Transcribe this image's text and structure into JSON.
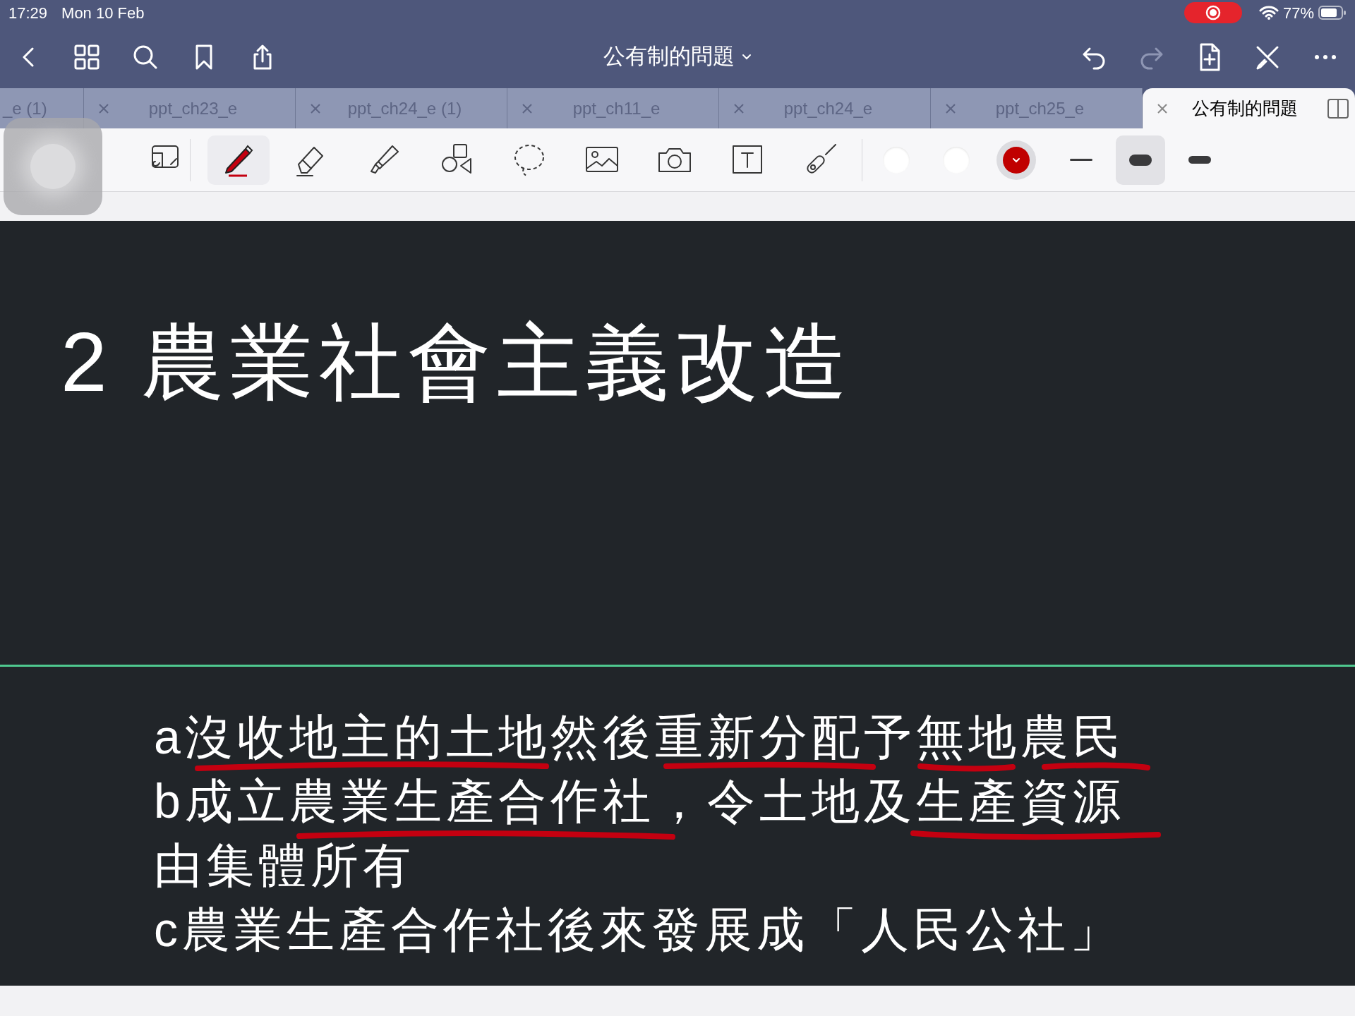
{
  "status_bar": {
    "time": "17:29",
    "date": "Mon 10 Feb",
    "recording": true,
    "battery": "77%"
  },
  "nav": {
    "title": "公有制的問題"
  },
  "tabs": [
    {
      "label": "_e (1)",
      "selected": false,
      "closable": false
    },
    {
      "label": "ppt_ch23_e",
      "selected": false,
      "closable": true
    },
    {
      "label": "ppt_ch24_e (1)",
      "selected": false,
      "closable": true
    },
    {
      "label": "ppt_ch11_e",
      "selected": false,
      "closable": true
    },
    {
      "label": "ppt_ch24_e",
      "selected": false,
      "closable": true
    },
    {
      "label": "ppt_ch25_e",
      "selected": false,
      "closable": true
    },
    {
      "label": "公有制的問題",
      "selected": true,
      "closable": true
    }
  ],
  "tools": [
    {
      "kind": "scan",
      "selected": false
    },
    {
      "kind": "pen",
      "selected": true
    },
    {
      "kind": "eraser",
      "selected": false
    },
    {
      "kind": "highlighter",
      "selected": false
    },
    {
      "kind": "shapes",
      "selected": false
    },
    {
      "kind": "lasso",
      "selected": false
    },
    {
      "kind": "image",
      "selected": false
    },
    {
      "kind": "camera",
      "selected": false
    },
    {
      "kind": "text",
      "selected": false
    },
    {
      "kind": "laser",
      "selected": false
    }
  ],
  "colors": [
    {
      "color": "#ffffff",
      "selected": false
    },
    {
      "color": "#ffffff",
      "selected": false
    },
    {
      "color": "#c00000",
      "selected": true
    }
  ],
  "widths": [
    {
      "kind": "thin",
      "selected": false
    },
    {
      "kind": "thick",
      "selected": true
    },
    {
      "kind": "medium",
      "selected": false
    }
  ],
  "slide": {
    "title": "2 農業社會主義改造",
    "lines": [
      "a沒收地主的土地然後重新分配予無地農民",
      "b成立農業生產合作社，令土地及生產資源",
      "由集體所有",
      "c農業生產合作社後來發展成「人民公社」"
    ]
  }
}
